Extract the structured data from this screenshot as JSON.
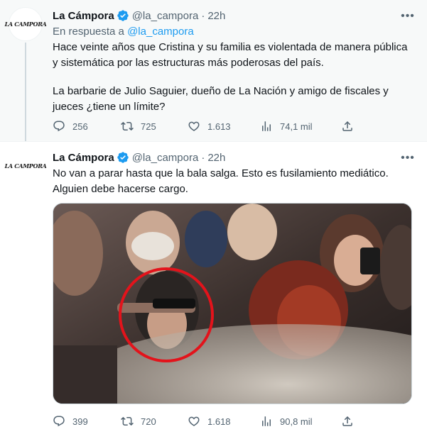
{
  "tweets": [
    {
      "avatar_text": "LA CAMPORA",
      "name": "La Cámpora",
      "handle": "@la_campora",
      "separator": "·",
      "time": "22h",
      "reply_prefix": "En respuesta a",
      "reply_mention": "@la_campora",
      "paragraphs": [
        "Hace veinte años que Cristina y su familia es violentada de manera pública y sistemática por las estructuras más poderosas del país.",
        "La barbarie de Julio Saguier, dueño de La Nación y amigo de fiscales y jueces ¿tiene un límite?"
      ],
      "stats": {
        "replies": "256",
        "retweets": "725",
        "likes": "1.613",
        "views": "74,1 mil"
      }
    },
    {
      "avatar_text": "LA CAMPORA",
      "name": "La Cámpora",
      "handle": "@la_campora",
      "separator": "·",
      "time": "22h",
      "paragraphs": [
        "No van a parar hasta que la bala salga. Esto es fusilamiento mediático. Alguien debe hacerse cargo."
      ],
      "stats": {
        "replies": "399",
        "retweets": "720",
        "likes": "1.618",
        "views": "90,8 mil"
      }
    }
  ],
  "colors": {
    "accent": "#1d9bf0",
    "secondary_text": "#536471",
    "primary_text": "#0f1419",
    "highlight_circle": "#e3131b"
  },
  "icons": [
    "verified-badge-icon",
    "more-icon",
    "reply-icon",
    "retweet-icon",
    "like-icon",
    "views-icon",
    "share-icon"
  ]
}
